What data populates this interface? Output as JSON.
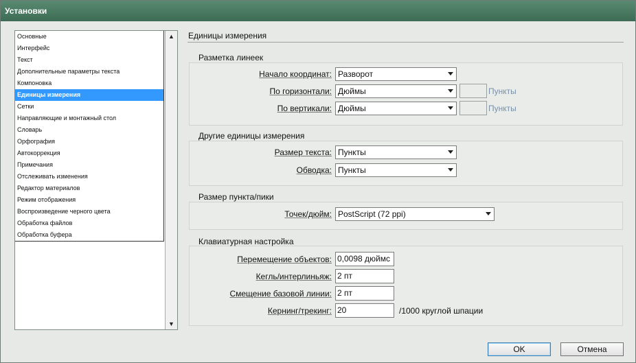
{
  "window": {
    "title": "Установки"
  },
  "sidebar": {
    "items": [
      "Основные",
      "Интерфейс",
      "Текст",
      "Дополнительные параметры текста",
      "Компоновка",
      "Единицы измерения",
      "Сетки",
      "Направляющие и монтажный стол",
      "Словарь",
      "Орфография",
      "Автокоррекция",
      "Примечания",
      "Отслеживать изменения",
      "Редактор материалов",
      "Режим отображения",
      "Воспроизведение черного цвета",
      "Обработка файлов",
      "Обработка буфера"
    ],
    "selected_index": 5
  },
  "content": {
    "title": "Единицы измерения",
    "rulers": {
      "title": "Разметка линеек",
      "origin_label": "Начало координат:",
      "origin_value": "Разворот",
      "horizontal_label": "По горизонтали:",
      "horizontal_value": "Дюймы",
      "horizontal_unit": "Пункты",
      "vertical_label": "По вертикали:",
      "vertical_value": "Дюймы",
      "vertical_unit": "Пункты"
    },
    "other_units": {
      "title": "Другие единицы измерения",
      "text_size_label": "Размер текста:",
      "text_size_value": "Пункты",
      "stroke_label": "Обводка:",
      "stroke_value": "Пункты"
    },
    "point_pica": {
      "title": "Размер пункта/пики",
      "ppi_label": "Точек/дюйм:",
      "ppi_value": "PostScript (72 ppi)"
    },
    "keyboard": {
      "title": "Клавиатурная настройка",
      "move_label": "Перемещение объектов:",
      "move_value": "0,0098 дюймс",
      "size_leading_label": "Кегль/интерлиньяж:",
      "size_leading_value": "2 пт",
      "baseline_label": "Смещение базовой линии:",
      "baseline_value": "2 пт",
      "kerning_label": "Кернинг/трекинг:",
      "kerning_value": "20",
      "kerning_note": "/1000 круглой шпации"
    }
  },
  "buttons": {
    "ok": "OK",
    "cancel": "Отмена"
  }
}
